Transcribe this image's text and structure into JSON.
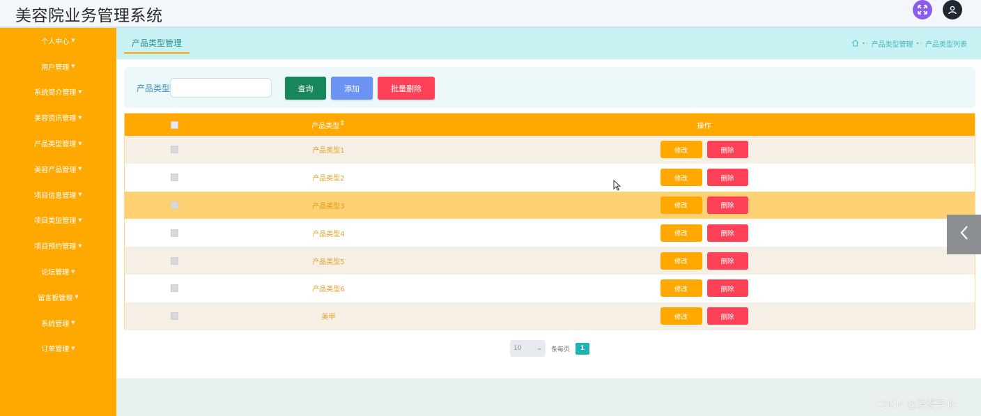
{
  "header": {
    "title": "美容院业务管理系统",
    "icons": [
      "fullscreen-icon",
      "user-icon"
    ]
  },
  "sidebar": {
    "items": [
      {
        "label": "个人中心"
      },
      {
        "label": "用户管理"
      },
      {
        "label": "系统简介管理"
      },
      {
        "label": "美容资讯管理"
      },
      {
        "label": "产品类型管理"
      },
      {
        "label": "美容产品管理"
      },
      {
        "label": "项目信息管理"
      },
      {
        "label": "项目类型管理"
      },
      {
        "label": "项目预约管理"
      },
      {
        "label": "论坛管理"
      },
      {
        "label": "留言板管理"
      },
      {
        "label": "系统管理"
      },
      {
        "label": "订单管理"
      }
    ]
  },
  "tabs": {
    "active": "产品类型管理"
  },
  "breadcrumb": {
    "items": [
      "产品类型管理",
      "产品类型列表"
    ]
  },
  "search": {
    "label": "产品类型",
    "value": "",
    "query_label": "查询",
    "add_label": "添加",
    "batch_delete_label": "批量删除"
  },
  "table": {
    "headers": {
      "type": "产品类型",
      "ops": "操作"
    },
    "sort_indicator": "⇕",
    "rows": [
      {
        "type": "产品类型1",
        "edit": "修改",
        "delete": "删除"
      },
      {
        "type": "产品类型2",
        "edit": "修改",
        "delete": "删除"
      },
      {
        "type": "产品类型3",
        "edit": "修改",
        "delete": "删除"
      },
      {
        "type": "产品类型4",
        "edit": "修改",
        "delete": "删除"
      },
      {
        "type": "产品类型5",
        "edit": "修改",
        "delete": "删除"
      },
      {
        "type": "产品类型6",
        "edit": "修改",
        "delete": "删除"
      },
      {
        "type": "美甲",
        "edit": "修改",
        "delete": "删除"
      }
    ]
  },
  "pagination": {
    "page_size": "10",
    "per_page_label": "条每页",
    "current_page": "1"
  },
  "watermark": "CSDN @爱得学长",
  "colors": {
    "accent": "#ffa800",
    "danger": "#ff4157",
    "teal": "#1fb3b3"
  }
}
